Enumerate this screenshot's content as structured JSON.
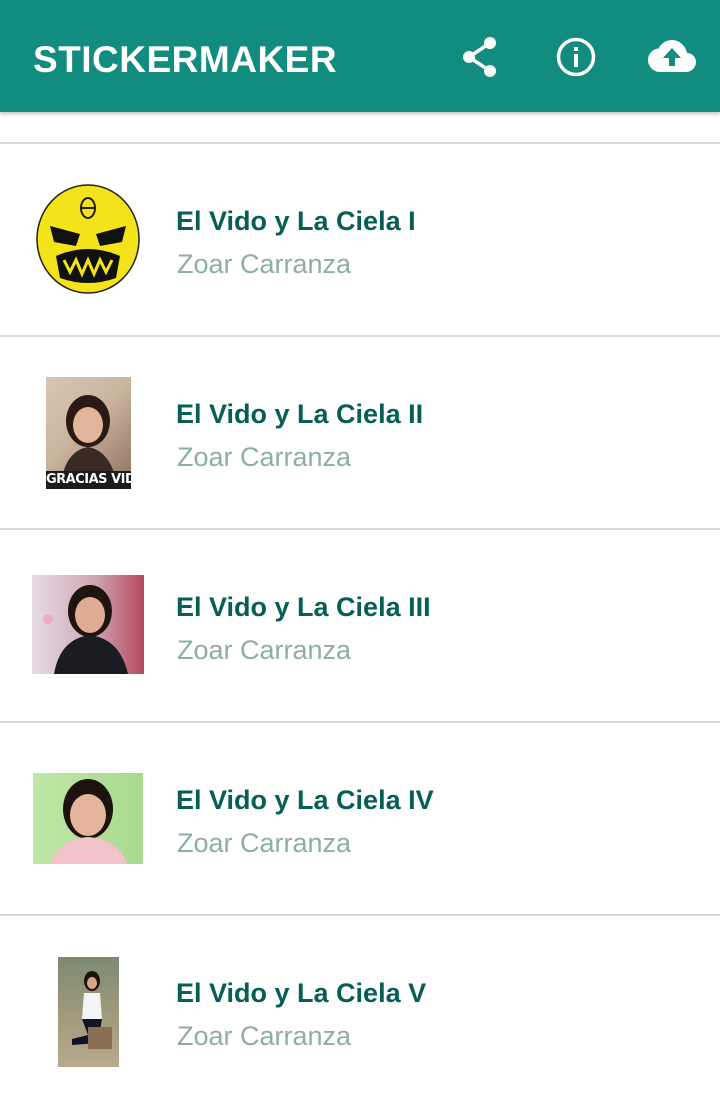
{
  "appbar": {
    "title": "STICKERMAKER",
    "color": "#128c7e",
    "actions": [
      {
        "icon": "share-icon"
      },
      {
        "icon": "info-icon"
      },
      {
        "icon": "cloud-upload-icon"
      }
    ]
  },
  "packs": [
    {
      "name": "El Vido y La Ciela I",
      "author": "Zoar Carranza",
      "thumbnail": "yellow-face-sticker"
    },
    {
      "name": "El Vido y La Ciela II",
      "author": "Zoar Carranza",
      "thumbnail": "portrait-photo",
      "caption": "GRACIAS VIDO!"
    },
    {
      "name": "El Vido y La Ciela III",
      "author": "Zoar Carranza",
      "thumbnail": "portrait-photo"
    },
    {
      "name": "El Vido y La Ciela IV",
      "author": "Zoar Carranza",
      "thumbnail": "portrait-photo"
    },
    {
      "name": "El Vido y La Ciela V",
      "author": "Zoar Carranza",
      "thumbnail": "full-body-photo"
    }
  ],
  "colors": {
    "name_text": "#075e54",
    "author_text": "#8fada8",
    "divider": "#d9d9d9"
  }
}
